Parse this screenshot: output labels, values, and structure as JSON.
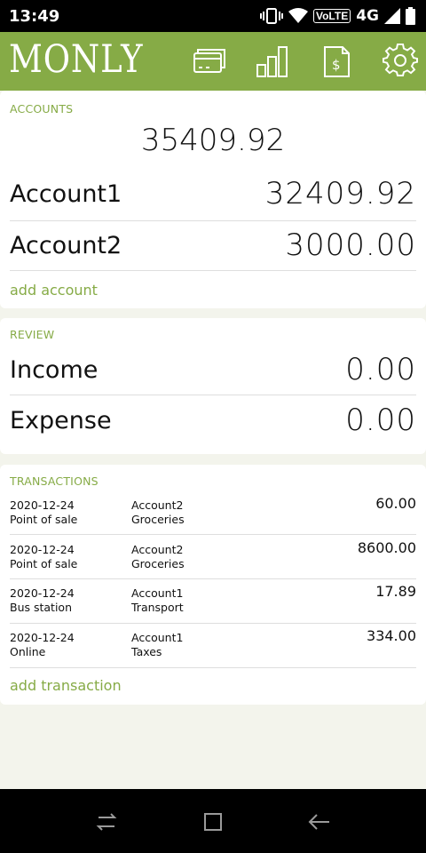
{
  "status_bar": {
    "time": "13:49",
    "volte": "VoLTE",
    "network": "4G"
  },
  "app": {
    "logo": "MONLY",
    "accent_color": "#86ab46"
  },
  "toolbar_icons": [
    "card-icon",
    "bar-chart-icon",
    "invoice-dollar-icon",
    "gear-icon"
  ],
  "accounts": {
    "label": "ACCOUNTS",
    "total": "35409.92",
    "items": [
      {
        "name": "Account1",
        "amount": "32409.92"
      },
      {
        "name": "Account2",
        "amount": "3000.00"
      }
    ],
    "add_label": "add account"
  },
  "review": {
    "label": "REVIEW",
    "items": [
      {
        "name": "Income",
        "amount": "0.00"
      },
      {
        "name": "Expense",
        "amount": "0.00"
      }
    ]
  },
  "transactions": {
    "label": "TRANSACTIONS",
    "rows": [
      {
        "date": "2020-12-24",
        "place": "Point of sale",
        "account": "Account2",
        "category": "Groceries",
        "amount": "60.00"
      },
      {
        "date": "2020-12-24",
        "place": "Point of sale",
        "account": "Account2",
        "category": "Groceries",
        "amount": "8600.00"
      },
      {
        "date": "2020-12-24",
        "place": "Bus station",
        "account": "Account1",
        "category": "Transport",
        "amount": "17.89"
      },
      {
        "date": "2020-12-24",
        "place": "Online",
        "account": "Account1",
        "category": "Taxes",
        "amount": "334.00"
      }
    ],
    "add_label": "add transaction"
  },
  "nav_icons": [
    "recents-icon",
    "home-icon",
    "back-icon"
  ]
}
